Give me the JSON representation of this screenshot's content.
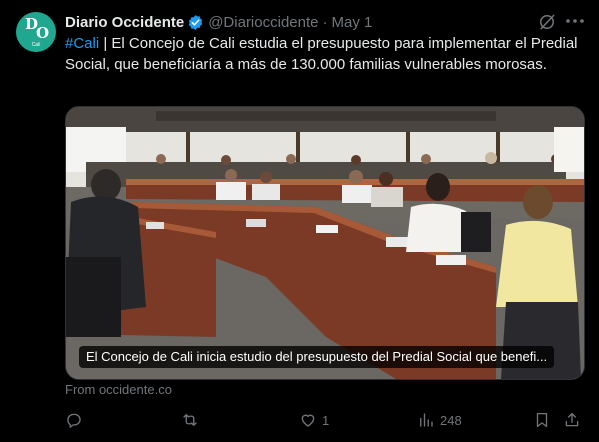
{
  "author": {
    "avatar_letters": [
      "D",
      "O"
    ],
    "avatar_caption": "Cali",
    "name": "Diario Occidente",
    "handle": "@Diarioccidente",
    "separator": "·",
    "date": "May 1"
  },
  "tweet": {
    "hashtag": "#Cali",
    "text": " | El Concejo de Cali estudia el presupuesto para implementar el Predial Social, que beneficiaría a más de 130.000 familias vulnerables morosas."
  },
  "media": {
    "caption": "El Concejo de Cali inicia estudio del presupuesto del Predial Social que benefi..."
  },
  "link_source": "From occidente.co",
  "actions": {
    "reply": {
      "icon": "reply-icon",
      "count": ""
    },
    "repost": {
      "icon": "repost-icon",
      "count": ""
    },
    "like": {
      "icon": "heart-icon",
      "count": "1"
    },
    "views": {
      "icon": "views-chart-icon",
      "count": "248"
    },
    "bookmark": {
      "icon": "bookmark-icon"
    },
    "share": {
      "icon": "share-icon"
    }
  },
  "colors": {
    "background": "#000000",
    "text": "#e7e9ea",
    "muted": "#71767b",
    "link": "#1d9bf0",
    "avatar": "#1fa88f"
  }
}
